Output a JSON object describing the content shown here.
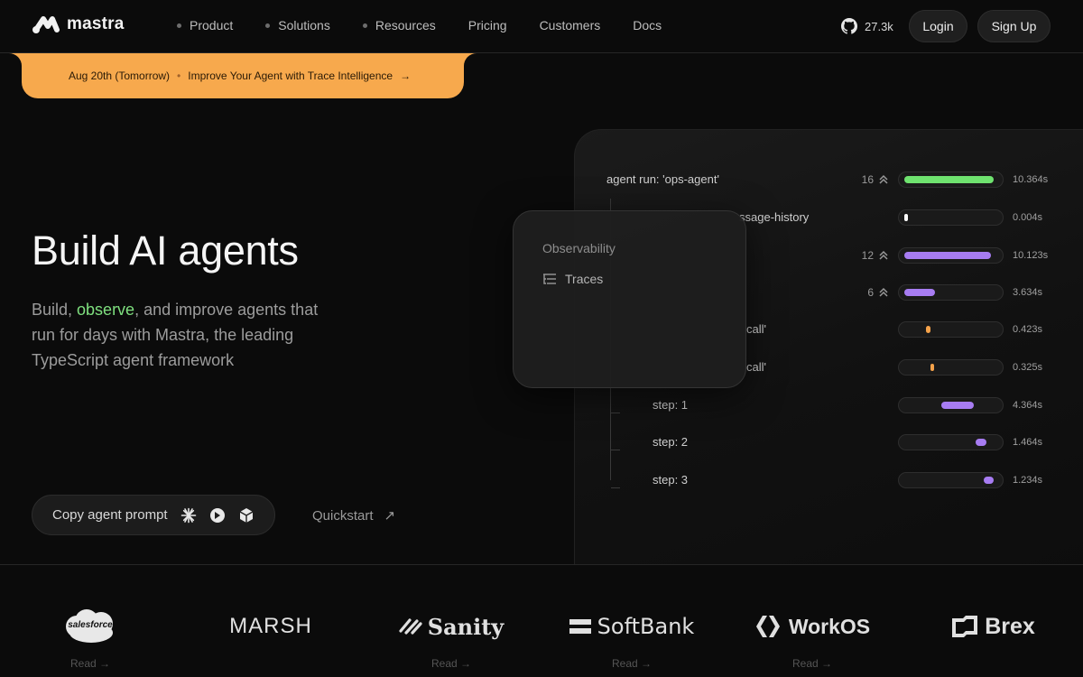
{
  "brand": {
    "name": "mastra"
  },
  "nav": {
    "links": [
      {
        "label": "Product",
        "dot": true
      },
      {
        "label": "Solutions",
        "dot": true
      },
      {
        "label": "Resources",
        "dot": true
      },
      {
        "label": "Pricing",
        "dot": false
      },
      {
        "label": "Customers",
        "dot": false
      },
      {
        "label": "Docs",
        "dot": false
      }
    ],
    "github_stars": "27.3k",
    "login": "Login",
    "signup": "Sign Up"
  },
  "banner": {
    "date": "Aug 20th (Tomorrow)",
    "separator": "•",
    "text": "Improve Your Agent with Trace Intelligence",
    "arrow": "→",
    "color": "#f7a94d"
  },
  "hero": {
    "title": "Build AI agents",
    "sub_pre": "Build, ",
    "sub_highlight": "observe",
    "sub_post": ", and improve agents that run for days with Mastra, the leading TypeScript agent framework",
    "copy_prompt": "Copy agent prompt",
    "quickstart": "Quickstart",
    "quickstart_arrow": "↗",
    "highlight_color": "#7fe07f"
  },
  "trace": {
    "rows": [
      {
        "label": "agent run: 'ops-agent'",
        "count": "16",
        "duration": "10.364s",
        "fill": 0.96,
        "offset": 0.0,
        "color": "#6fe36f"
      },
      {
        "label": "ssage-history",
        "count": "",
        "duration": "0.004s",
        "fill": 0.03,
        "offset": 0.0,
        "color": "#ffffff"
      },
      {
        "label": "",
        "count": "12",
        "duration": "10.123s",
        "fill": 0.93,
        "offset": 0.0,
        "color": "#a77cf2"
      },
      {
        "label": "",
        "count": "6",
        "duration": "3.634s",
        "fill": 0.33,
        "offset": 0.0,
        "color": "#a77cf2"
      },
      {
        "label": "call'",
        "count": "",
        "duration": "0.423s",
        "fill": 0.05,
        "offset": 0.23,
        "color": "#f5a24a"
      },
      {
        "label": "call'",
        "count": "",
        "duration": "0.325s",
        "fill": 0.04,
        "offset": 0.28,
        "color": "#f5a24a"
      },
      {
        "label": "step: 1",
        "count": "",
        "duration": "4.364s",
        "fill": 0.35,
        "offset": 0.4,
        "color": "#a77cf2"
      },
      {
        "label": "step: 2",
        "count": "",
        "duration": "1.464s",
        "fill": 0.12,
        "offset": 0.77,
        "color": "#a77cf2"
      },
      {
        "label": "step: 3",
        "count": "",
        "duration": "1.234s",
        "fill": 0.11,
        "offset": 0.85,
        "color": "#a77cf2"
      }
    ]
  },
  "popup": {
    "title": "Observability",
    "item": "Traces"
  },
  "customers": {
    "read_label": "Read →",
    "items": [
      {
        "name": "salesforce",
        "read": true
      },
      {
        "name": "MARSH",
        "read": false
      },
      {
        "name": "Sanity",
        "read": true
      },
      {
        "name": "SoftBank",
        "read": true
      },
      {
        "name": "WorkOS",
        "read": true
      },
      {
        "name": "Brex",
        "read": false
      }
    ]
  }
}
